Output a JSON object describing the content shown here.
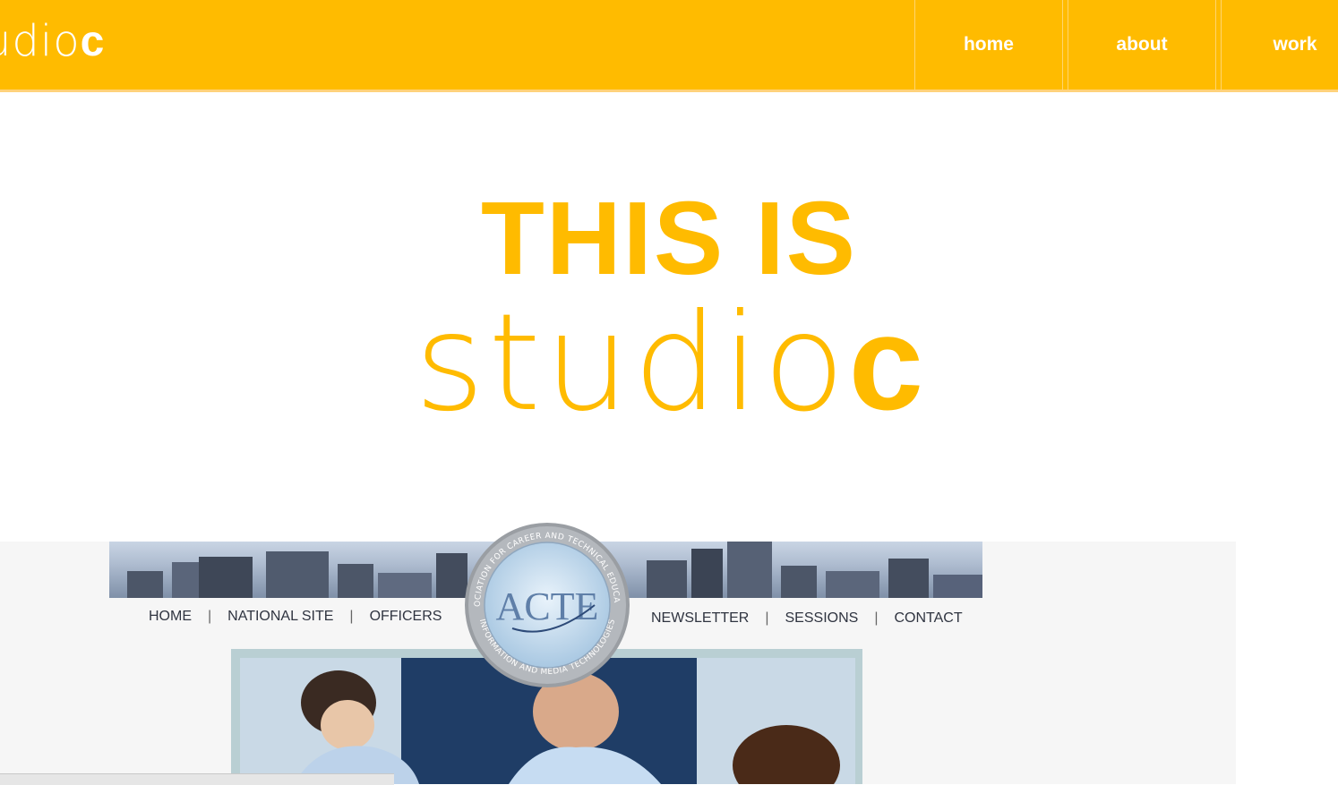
{
  "header": {
    "logo_thin": "udio",
    "logo_bold": "c",
    "nav": [
      {
        "label": "home"
      },
      {
        "label": "about"
      },
      {
        "label": "work"
      }
    ]
  },
  "hero": {
    "line1": "THIS IS",
    "line2_thin": "studio",
    "line2_bold": "c"
  },
  "preview": {
    "nav_left": [
      "HOME",
      "NATIONAL SITE",
      "OFFICERS"
    ],
    "nav_right": [
      "NEWSLETTER",
      "SESSIONS",
      "CONTACT"
    ],
    "separator": "|",
    "seal_text": "ACTE",
    "seal_ring_top": "ASSOCIATION FOR CAREER AND TECHNICAL EDUCATION",
    "seal_ring_bottom": "INFORMATION AND MEDIA TECHNOLOGIES"
  },
  "colors": {
    "brand": "#ffbb00",
    "white": "#ffffff",
    "nav_text": "#2f3440"
  }
}
